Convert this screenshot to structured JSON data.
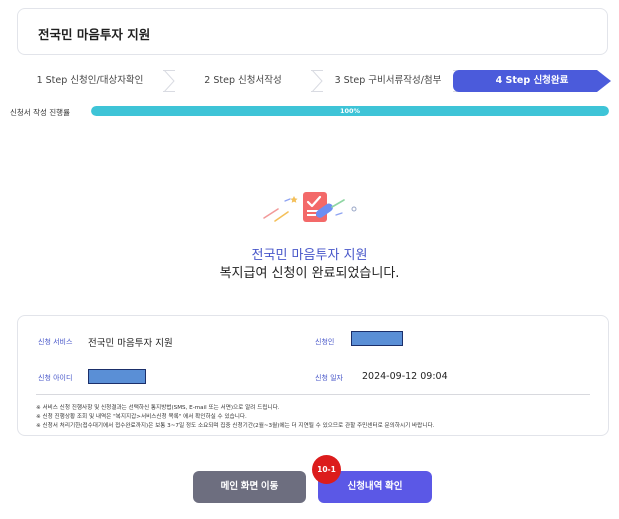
{
  "page_title": "전국민 마음투자 지원",
  "steps": [
    {
      "label": "1 Step 신청인/대상자확인"
    },
    {
      "label": "2 Step 신청서작성"
    },
    {
      "label": "3 Step 구비서류작성/첨부"
    },
    {
      "label": "4 Step 신청완료",
      "active": true
    }
  ],
  "progress": {
    "label": "신청서 작성 진행률",
    "value_text": "100%",
    "value": 100
  },
  "completion": {
    "service_name": "전국민 마음투자 지원",
    "message": "복지급여 신청이 완료되었습니다."
  },
  "info": {
    "service_label": "신청 서비스",
    "service_value": "전국민 마음투자 지원",
    "applicant_label": "신청인",
    "id_label": "신청 아이디",
    "date_label": "신청 일자",
    "date_value": "2024-09-12 09:04"
  },
  "notes": [
    "※ 서비스 신청 진행사항 및 신청결과는 선택하신 통지방법(SMS, E-mail 또는 서면)으로 알려 드립니다.",
    "※ 신청 진행상황 조회 및 내역은 \"복지지갑>서비스신청 목록\" 에서 확인하실 수 있습니다.",
    "※ 신청서 처리기한(접수대기에서 접수완료까지)은 보통 3~7일 정도 소요되며 집중 신청기간(2월~3월)에는 더 지연될 수 있으므로 관할 주민센터로 문의하시기 바랍니다."
  ],
  "buttons": {
    "main": "메인 화면 이동",
    "check": "신청내역 확인"
  },
  "badge": "10-1",
  "colors": {
    "accent": "#4b5bdb",
    "progress": "#3ec4d7",
    "badge": "#dc1c1c"
  }
}
